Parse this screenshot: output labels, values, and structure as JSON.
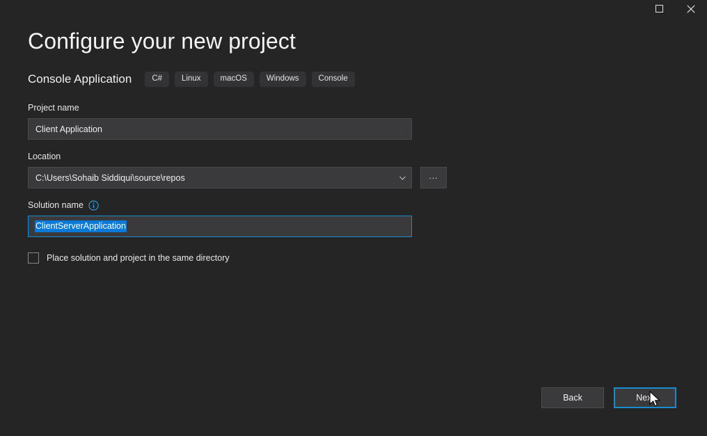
{
  "window": {
    "controls": [
      {
        "name": "maximize-button",
        "icon": "square-icon",
        "label": "Maximize"
      },
      {
        "name": "close-button",
        "icon": "close-icon",
        "label": "Close"
      }
    ]
  },
  "header": {
    "title": "Configure your new project",
    "template_name": "Console Application",
    "tags": [
      "C#",
      "Linux",
      "macOS",
      "Windows",
      "Console"
    ]
  },
  "form": {
    "project_name": {
      "label": "Project name",
      "value": "Client Application"
    },
    "location": {
      "label": "Location",
      "value": "C:\\Users\\Sohaib Siddiqui\\source\\repos",
      "dropdown_icon": "chevron-down-icon",
      "browse_label": "...",
      "browse_title": "Browse"
    },
    "solution_name": {
      "label": "Solution name",
      "info_icon": "info-icon",
      "value": "ClientServerApplication",
      "selected": true,
      "focused": true
    },
    "same_directory_checkbox": {
      "label": "Place solution and project in the same directory",
      "checked": false
    }
  },
  "footer": {
    "back_label": "Back",
    "next_label": "Next"
  },
  "colors": {
    "background": "#252526",
    "input_background": "#3a3a3c",
    "input_border": "#4a4a4c",
    "accent": "#1b8bd0",
    "selection": "#0a7ad8",
    "tag_background": "#333335",
    "text": "#f0f0f0"
  }
}
